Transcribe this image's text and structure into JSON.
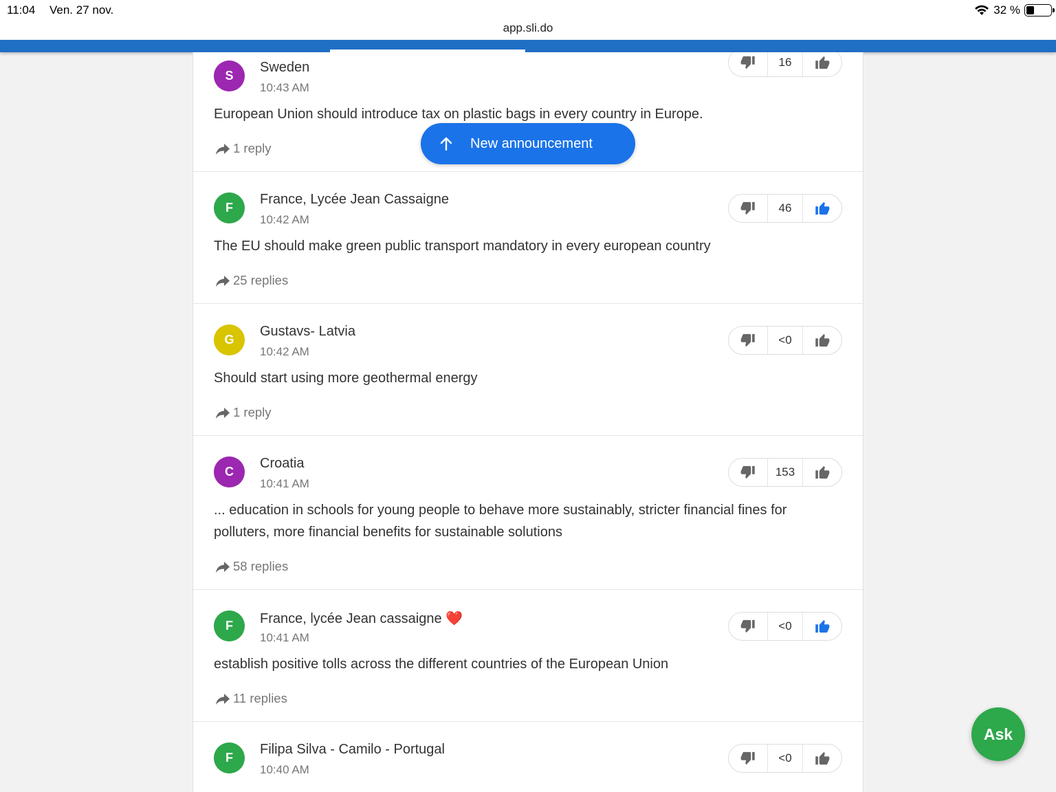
{
  "status": {
    "time": "11:04",
    "date": "Ven. 27 nov.",
    "battery": "32 %"
  },
  "browser": {
    "url": "app.sli.do"
  },
  "announcement": {
    "label": "New announcement"
  },
  "ask": {
    "label": "Ask"
  },
  "questions": [
    {
      "initial": "S",
      "avatar_color": "#9c27b0",
      "author": "Sweden",
      "time": "10:43 AM",
      "text": "European Union should introduce tax on plastic bags in every country in Europe.",
      "replies": "1 reply",
      "votes": "16",
      "liked": false
    },
    {
      "initial": "F",
      "avatar_color": "#2da84a",
      "author": "France, Lycée Jean Cassaigne",
      "time": "10:42 AM",
      "text": "The EU should make green public transport mandatory in every european country",
      "replies": "25 replies",
      "votes": "46",
      "liked": true
    },
    {
      "initial": "G",
      "avatar_color": "#d9c400",
      "author": "Gustavs- Latvia",
      "time": "10:42 AM",
      "text": "Should start using more geothermal energy",
      "replies": "1 reply",
      "votes": "<0",
      "liked": false
    },
    {
      "initial": "C",
      "avatar_color": "#9c27b0",
      "author": "Croatia",
      "time": "10:41 AM",
      "text": "... education in schools for young people to behave more sustainably, stricter financial fines for polluters, more financial benefits for sustainable solutions",
      "replies": "58 replies",
      "votes": "153",
      "liked": false
    },
    {
      "initial": "F",
      "avatar_color": "#2da84a",
      "author": "France, lycée Jean cassaigne ❤️",
      "time": "10:41 AM",
      "text": "establish positive tolls across the different countries of the European Union",
      "replies": "11 replies",
      "votes": "<0",
      "liked": true
    },
    {
      "initial": "F",
      "avatar_color": "#2da84a",
      "author": "Filipa Silva - Camilo - Portugal",
      "time": "10:40 AM",
      "text": "",
      "replies": "",
      "votes": "<0",
      "liked": false
    }
  ]
}
